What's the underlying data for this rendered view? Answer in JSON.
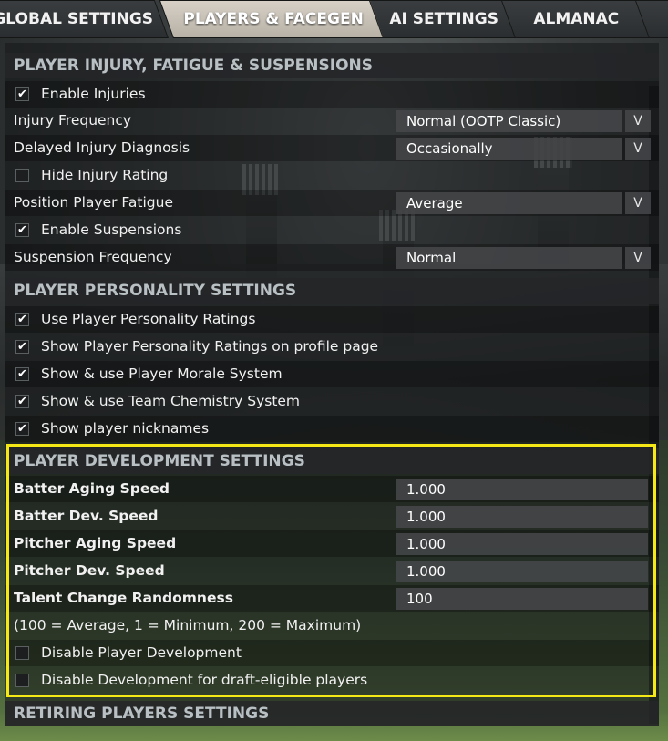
{
  "tabs": [
    {
      "label": "GLOBAL SETTINGS",
      "active": false
    },
    {
      "label": "PLAYERS & FACEGEN",
      "active": true
    },
    {
      "label": "AI SETTINGS",
      "active": false
    },
    {
      "label": "ALMANAC",
      "active": false
    }
  ],
  "injury": {
    "header": "PLAYER INJURY, FATIGUE & SUSPENSIONS",
    "enable_injuries": {
      "label": "Enable Injuries",
      "checked": true
    },
    "injury_frequency": {
      "label": "Injury Frequency",
      "value": "Normal (OOTP Classic)"
    },
    "delayed_diagnosis": {
      "label": "Delayed Injury Diagnosis",
      "value": "Occasionally"
    },
    "hide_rating": {
      "label": "Hide Injury Rating",
      "checked": false
    },
    "fatigue": {
      "label": "Position Player Fatigue",
      "value": "Average"
    },
    "enable_suspensions": {
      "label": "Enable Suspensions",
      "checked": true
    },
    "suspension_frequency": {
      "label": "Suspension Frequency",
      "value": "Normal"
    }
  },
  "personality": {
    "header": "PLAYER PERSONALITY SETTINGS",
    "items": [
      {
        "label": "Use Player Personality Ratings",
        "checked": true
      },
      {
        "label": "Show Player Personality Ratings on profile page",
        "checked": true
      },
      {
        "label": "Show & use Player Morale System",
        "checked": true
      },
      {
        "label": "Show & use Team Chemistry System",
        "checked": true
      },
      {
        "label": "Show player nicknames",
        "checked": true
      }
    ]
  },
  "development": {
    "header": "PLAYER DEVELOPMENT SETTINGS",
    "fields": [
      {
        "label": "Batter Aging Speed",
        "value": "1.000"
      },
      {
        "label": "Batter Dev. Speed",
        "value": "1.000"
      },
      {
        "label": "Pitcher Aging Speed",
        "value": "1.000"
      },
      {
        "label": "Pitcher Dev. Speed",
        "value": "1.000"
      },
      {
        "label": "Talent Change Randomness",
        "value": "100"
      }
    ],
    "note": "(100 = Average, 1 = Minimum, 200 = Maximum)",
    "disable_dev": {
      "label": "Disable Player Development",
      "checked": false
    },
    "disable_draft": {
      "label": "Disable Development for draft-eligible players",
      "checked": false
    }
  },
  "retiring": {
    "header": "RETIRING PLAYERS SETTINGS"
  },
  "icons": {
    "dropdown": "chevron-down-icon",
    "checkmark": "checkmark-icon"
  },
  "colors": {
    "highlight": "#f4e816",
    "section_text": "#b9c0c4",
    "active_tab": "#c9c2b7"
  }
}
